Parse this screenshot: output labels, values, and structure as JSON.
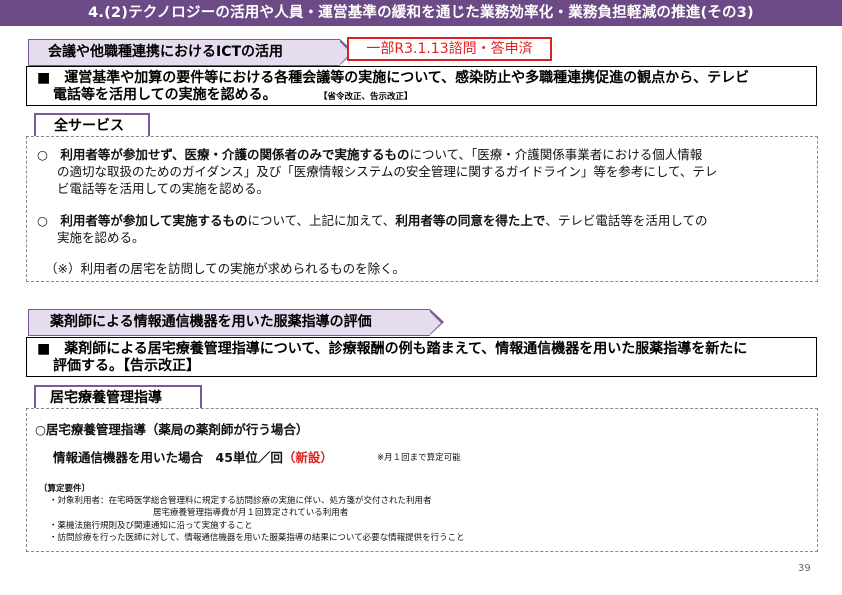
{
  "header": {
    "title": "4.(2)テクノロジーの活用や人員・運営基準の緩和を通じた業務効率化・業務負担軽減の推進(その3)"
  },
  "section1": {
    "tag": "会議や他職種連携におけるICTの活用",
    "status_box": "一部R3.1.13諮問・答申済",
    "summary_line1": "■　運営基準や加算の要件等における各種会議等の実施について、感染防止や多職種連携促進の観点から、テレビ",
    "summary_line2": "電話等を活用しての実施を認める。",
    "summary_note": "【省令改正、告示改正】",
    "scope_label": "全サービス",
    "item1_lead": "○　利用者等が参加せず、医療・介護の関係者のみで実施するもの",
    "item1_rest": "について、「医療・介護関係事業者における個人情報",
    "item1_line2": "の適切な取扱のためのガイダンス」及び「医療情報システムの安全管理に関するガイドライン」等を参考にして、テレ",
    "item1_line3": "ビ電話等を活用しての実施を認める。",
    "item2_lead": "○　利用者等が参加して実施するもの",
    "item2_mid": "について、上記に加えて、",
    "item2_bold2": "利用者等の同意を得た上で",
    "item2_rest": "、テレビ電話等を活用しての",
    "item2_line2": "実施を認める。",
    "note": "（※）利用者の居宅を訪問しての実施が求められるものを除く。"
  },
  "section2": {
    "tag": "薬剤師による情報通信機器を用いた服薬指導の評価",
    "summary_line1": "■　薬剤師による居宅療養管理指導について、診療報酬の例も踏まえて、情報通信機器を用いた服薬指導を新たに",
    "summary_line2": "評価する。【告示改正】",
    "scope_label": "居宅療養管理指導",
    "item_title": "○居宅療養管理指導（薬局の薬剤師が行う場合）",
    "fee_text": "情報通信機器を用いた場合　45単位／回",
    "fee_new": "（新設）",
    "fee_note": "※月１回まで算定可能",
    "req_head": "〔算定要件〕",
    "req1": "・対象利用者：在宅時医学総合管理料に規定する訪問診療の実施に伴い、処方箋が交付された利用者",
    "req1b": "居宅療養管理指導費が月１回算定されている利用者",
    "req2": "・薬機法施行規則及び関連通知に沿って実施すること",
    "req3": "・訪問診療を行った医師に対して、情報通信機器を用いた服薬指導の結果について必要な情報提供を行うこと"
  },
  "footer": {
    "page_number": "39"
  },
  "colors": {
    "header_bg": "#6b4a86",
    "tag_bg": "#e6dcef",
    "tag_border": "#7b5a99",
    "accent_red": "#e02020"
  }
}
